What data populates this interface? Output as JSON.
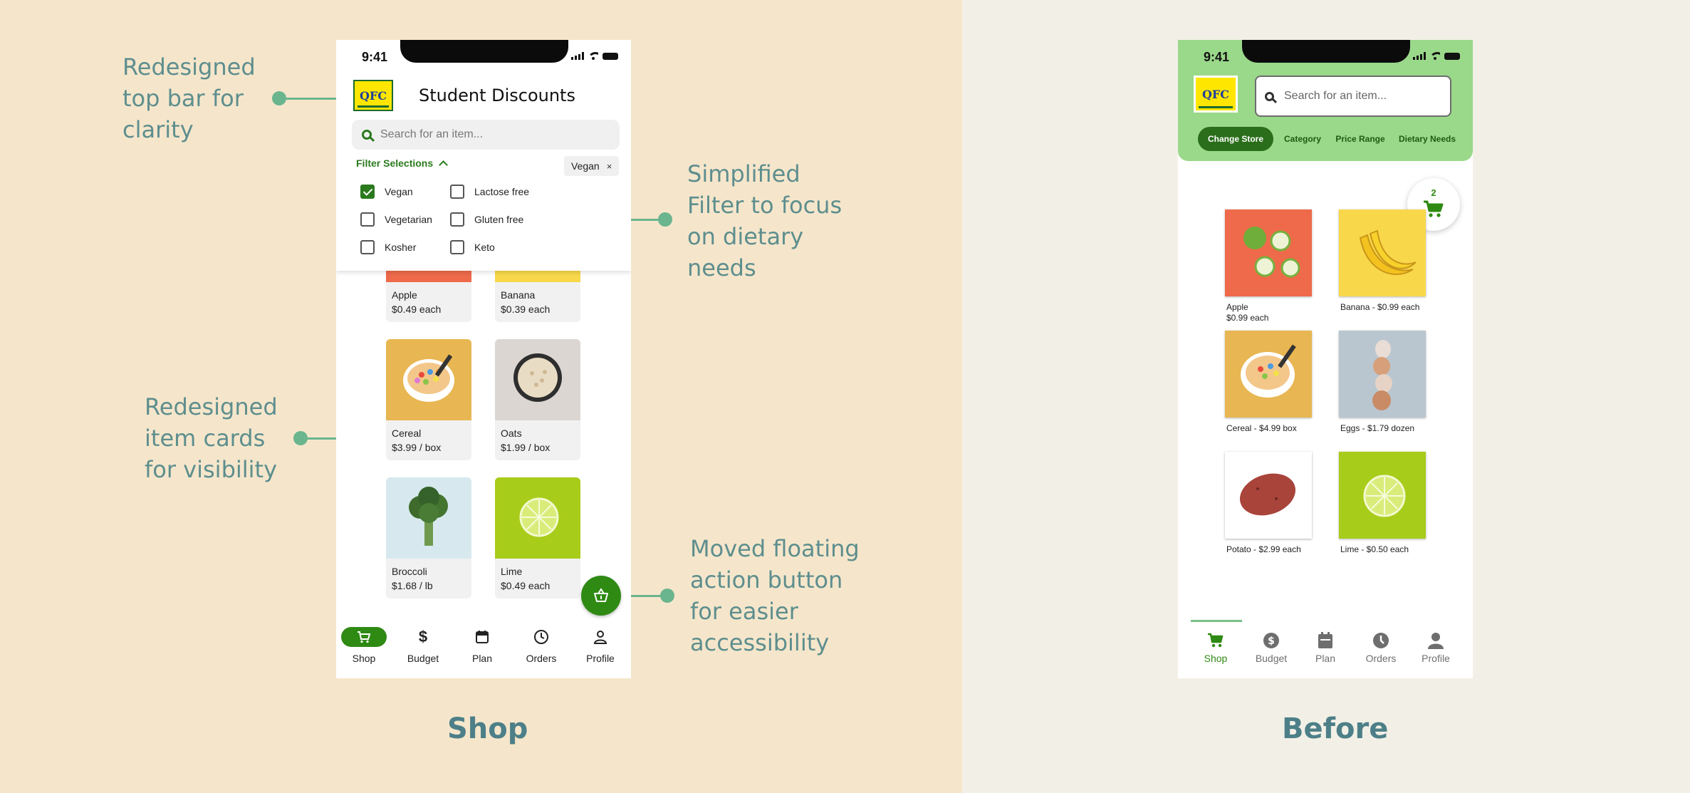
{
  "annotations": {
    "topbar": [
      "Redesigned",
      "top bar for",
      "clarity"
    ],
    "filter": [
      "Simplified",
      "Filter to focus",
      "on dietary",
      "needs"
    ],
    "cards": [
      "Redesigned",
      "item cards",
      "for visibility"
    ],
    "fab": [
      "Moved floating",
      "action button",
      "for easier",
      "accessibility"
    ]
  },
  "captions": {
    "left": "Shop",
    "right": "Before"
  },
  "status": {
    "time": "9:41"
  },
  "new_design": {
    "logo": "QFC",
    "title": "Student Discounts",
    "search_placeholder": "Search for an item...",
    "filter_label": "Filter Selections",
    "active_chip": "Vegan",
    "chip_close": "×",
    "filters": [
      {
        "label": "Vegan",
        "checked": true
      },
      {
        "label": "Lactose free",
        "checked": false
      },
      {
        "label": "Vegetarian",
        "checked": false
      },
      {
        "label": "Gluten free",
        "checked": false
      },
      {
        "label": "Kosher",
        "checked": false
      },
      {
        "label": "Keto",
        "checked": false
      }
    ],
    "items": [
      {
        "name": "Apple",
        "price": "$0.49 each"
      },
      {
        "name": "Banana",
        "price": "$0.39 each"
      },
      {
        "name": "Cereal",
        "price": "$3.99 / box"
      },
      {
        "name": "Oats",
        "price": "$1.99 / box"
      },
      {
        "name": "Broccoli",
        "price": "$1.68 / lb"
      },
      {
        "name": "Lime",
        "price": "$0.49 each"
      }
    ],
    "tabs": [
      "Shop",
      "Budget",
      "Plan",
      "Orders",
      "Profile"
    ],
    "tab_icons": [
      "cart-icon",
      "dollar-icon",
      "calendar-icon",
      "clock-icon",
      "person-icon"
    ]
  },
  "old_design": {
    "logo": "QFC",
    "search_placeholder": "Search for an item...",
    "pills": [
      "Change Store",
      "Category",
      "Price Range",
      "Dietary Needs"
    ],
    "cart_count": "2",
    "items": [
      {
        "label": "Apple",
        "label2": "$0.99 each"
      },
      {
        "label": "Banana - $0.99 each",
        "label2": ""
      },
      {
        "label": "Cereal - $4.99 box",
        "label2": ""
      },
      {
        "label": "Eggs - $1.79 dozen",
        "label2": ""
      },
      {
        "label": "Potato - $2.99 each",
        "label2": ""
      },
      {
        "label": "Lime - $0.50 each",
        "label2": ""
      }
    ],
    "tabs": [
      "Shop",
      "Budget",
      "Plan",
      "Orders",
      "Profile"
    ]
  },
  "colors": {
    "left_bg": "#f5e6cb",
    "right_bg": "#f2f0e6",
    "annotation_text": "#5e8e8e",
    "connector": "#6ab58e",
    "brand_green": "#2f8a14",
    "old_header": "#9ad88a"
  }
}
